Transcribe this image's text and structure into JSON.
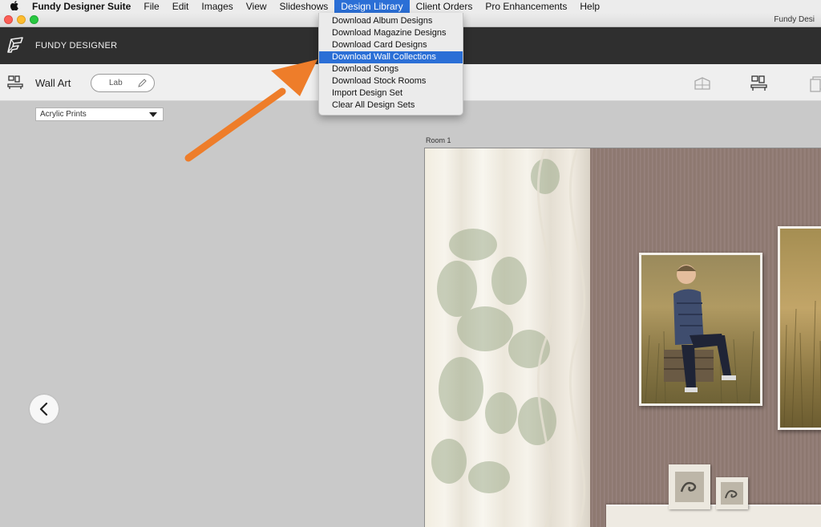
{
  "menubar": {
    "app_name": "Fundy Designer Suite",
    "items": [
      "File",
      "Edit",
      "Images",
      "View",
      "Slideshows",
      "Design Library",
      "Client Orders",
      "Pro Enhancements",
      "Help"
    ],
    "active": "Design Library"
  },
  "window": {
    "title": "Fundy Desi"
  },
  "app_header": {
    "name": "FUNDY DESIGNER"
  },
  "toolbar": {
    "section_label": "Wall Art",
    "lab_label": "Lab"
  },
  "product_select": {
    "value": "Acrylic Prints"
  },
  "room": {
    "label": "Room 1"
  },
  "design_library_menu": {
    "items": [
      "Download Album Designs",
      "Download Magazine Designs",
      "Download Card Designs",
      "Download Wall Collections",
      "Download Songs",
      "Download Stock Rooms",
      "Import Design Set",
      "Clear All Design Sets"
    ],
    "highlighted": "Download Wall Collections"
  },
  "colors": {
    "menu_highlight": "#2b6fd6",
    "header_bg": "#2f2f2f",
    "arrow": "#ee7d2a",
    "wall": "#8f7a72"
  },
  "icons": {
    "apple": "apple-logo-icon",
    "logo": "fundy-logo-icon",
    "wall_art": "wall-art-icon",
    "pencil": "pencil-icon",
    "prev": "chevron-left-icon"
  }
}
